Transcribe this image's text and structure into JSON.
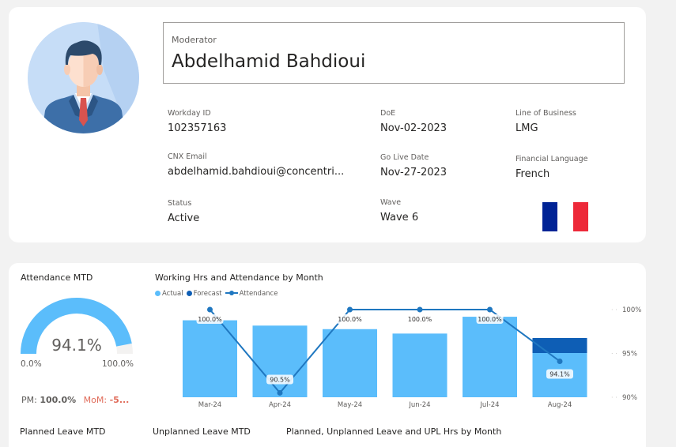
{
  "profile": {
    "role_label": "Moderator",
    "name": "Abdelhamid Bahdioui",
    "fields": {
      "workday_id": {
        "label": "Workday ID",
        "value": "102357163"
      },
      "doe": {
        "label": "DoE",
        "value": "Nov-02-2023"
      },
      "line_of_business": {
        "label": "Line of Business",
        "value": "LMG"
      },
      "cnx_email": {
        "label": "CNX Email",
        "value": "abdelhamid.bahdioui@concentri..."
      },
      "go_live_date": {
        "label": "Go Live Date",
        "value": "Nov-27-2023"
      },
      "financial_language": {
        "label": "Financial Language",
        "value": "French"
      },
      "status": {
        "label": "Status",
        "value": "Active"
      },
      "wave": {
        "label": "Wave",
        "value": "Wave 6"
      }
    },
    "flag": {
      "name": "france-flag-icon",
      "colors": [
        "#002395",
        "#ffffff",
        "#ed2939"
      ]
    }
  },
  "attendance": {
    "title": "Attendance MTD",
    "value": 94.1,
    "value_label": "94.1%",
    "min_label": "0.0%",
    "max_label": "100.0%",
    "pm_label": "PM:",
    "pm_value": "100.0%",
    "mom_label": "MoM:",
    "mom_value": "-5...",
    "colors": {
      "fill": "#5bbdfb",
      "track": "#f3f2f1"
    }
  },
  "chart_data": {
    "type": "bar",
    "title": "Working Hrs and Attendance by Month",
    "legend": [
      "Actual",
      "Forecast",
      "Attendance"
    ],
    "legend_position": "top-left",
    "categories": [
      "Mar-24",
      "Apr-24",
      "May-24",
      "Jun-24",
      "Jul-24",
      "Aug-24"
    ],
    "series": [
      {
        "name": "Actual",
        "kind": "bar",
        "values": [
          0.87,
          0.81,
          0.77,
          0.72,
          0.91,
          0.5
        ],
        "color": "#5bbdfb"
      },
      {
        "name": "Forecast",
        "kind": "bar",
        "values": [
          0,
          0,
          0,
          0,
          0,
          0.17
        ],
        "color": "#0e5eb5"
      },
      {
        "name": "Attendance",
        "kind": "line",
        "values": [
          100.0,
          90.5,
          100.0,
          100.0,
          100.0,
          94.1
        ],
        "labels": [
          "100.0%",
          "90.5%",
          "100.0%",
          "100.0%",
          "100.0%",
          "94.1%"
        ],
        "color": "#1f77c0"
      }
    ],
    "y2_ticks": [
      "100%",
      "95%",
      "90%"
    ],
    "y2lim": [
      90,
      100
    ],
    "grid": false
  },
  "bottom": {
    "planned_title": "Planned Leave MTD",
    "unplanned_title": "Unplanned Leave MTD",
    "leave_chart_title": "Planned, Unplanned Leave and UPL Hrs by Month"
  }
}
